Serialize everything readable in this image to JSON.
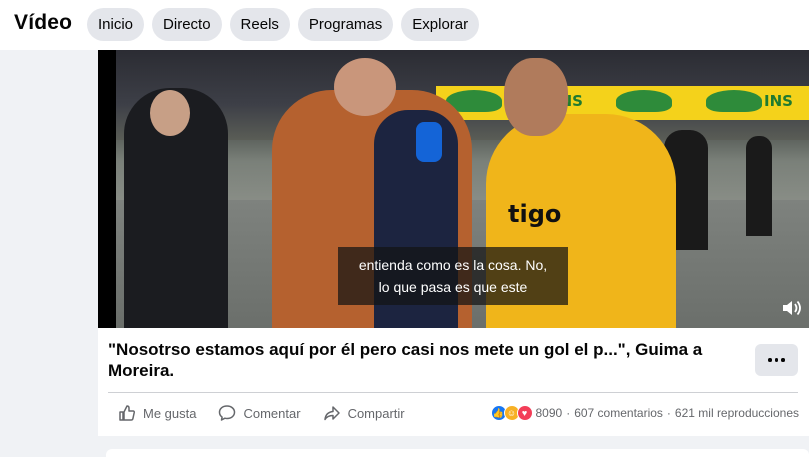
{
  "header": {
    "title": "Vídeo",
    "tabs": [
      {
        "label": "Inicio"
      },
      {
        "label": "Directo"
      },
      {
        "label": "Reels"
      },
      {
        "label": "Programas"
      },
      {
        "label": "Explorar"
      }
    ]
  },
  "video": {
    "subtitle_line1": "entienda como es la cosa. No,",
    "subtitle_line2": "lo que pasa es que este",
    "banner_text": "INS",
    "jersey_text": "tigo"
  },
  "post": {
    "caption": "\"Nosotrso estamos aquí por él pero casi nos mete un gol el p...\", Guima a Moreira.",
    "actions": {
      "like_label": "Me gusta",
      "comment_label": "Comentar",
      "share_label": "Compartir"
    },
    "stats": {
      "reactions_count": "8090",
      "comments": "607 comentarios",
      "separator": "·",
      "views": "621 mil reproducciones"
    }
  },
  "colors": {
    "accent": "#1877f2",
    "tab_bg": "#e4e6eb",
    "page_bg": "#f0f2f5",
    "love": "#f33e58",
    "haha": "#f7b125"
  },
  "icons": {
    "like": "thumbs-up-icon",
    "comment": "comment-bubble-icon",
    "share": "share-arrow-icon",
    "more": "more-options-icon",
    "volume": "volume-icon"
  }
}
